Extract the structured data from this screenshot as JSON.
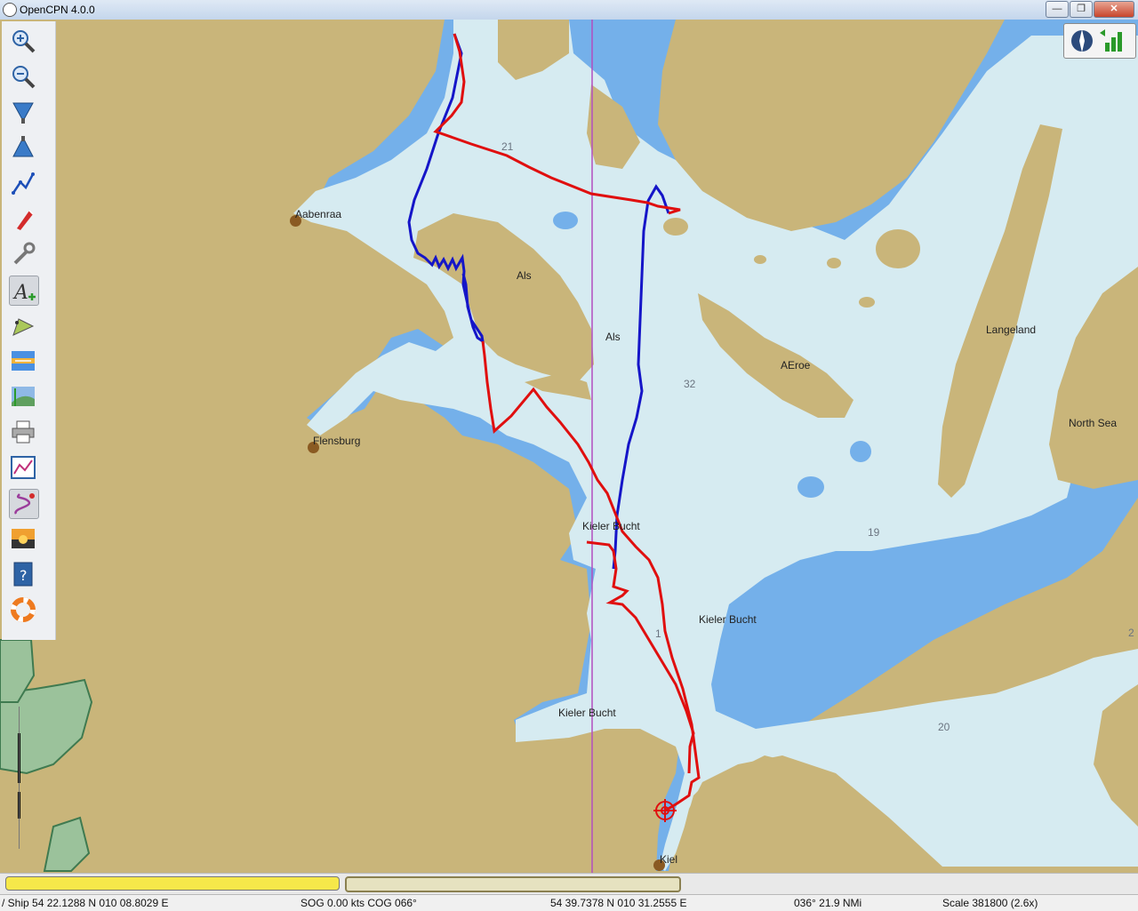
{
  "window": {
    "title": "OpenCPN 4.0.0",
    "minimize": "—",
    "maximize": "❐",
    "close": "✕"
  },
  "colors": {
    "land": "#c9b57a",
    "shallow": "#74b0ea",
    "deep": "#d6ebf1",
    "route_blue": "#1515c8",
    "track_red": "#e00f0f",
    "meridian": "#b24ec0"
  },
  "toolbar": {
    "items": [
      {
        "name": "zoom-in-tool",
        "icon": "zoom-in-icon"
      },
      {
        "name": "zoom-out-tool",
        "icon": "zoom-out-icon"
      },
      {
        "name": "scale-in-tool",
        "icon": "chart-scale-in-icon"
      },
      {
        "name": "scale-out-tool",
        "icon": "chart-scale-out-icon"
      },
      {
        "name": "route-tool",
        "icon": "route-icon"
      },
      {
        "name": "auto-follow-tool",
        "icon": "ship-follow-icon"
      },
      {
        "name": "settings-tool",
        "icon": "wrench-icon"
      },
      {
        "name": "text-tool",
        "icon": "text-add-icon",
        "active": true
      },
      {
        "name": "current-tool",
        "icon": "current-arrow-icon"
      },
      {
        "name": "tide-tool",
        "icon": "tide-icon"
      },
      {
        "name": "route-manager-tool",
        "icon": "route-manager-icon"
      },
      {
        "name": "print-tool",
        "icon": "printer-icon"
      },
      {
        "name": "chart-tool",
        "icon": "chart-graph-icon"
      },
      {
        "name": "track-tool",
        "icon": "track-icon",
        "active": true
      },
      {
        "name": "color-scheme-tool",
        "icon": "sunset-icon"
      },
      {
        "name": "help-tool",
        "icon": "help-book-icon"
      },
      {
        "name": "mob-tool",
        "icon": "lifebuoy-icon"
      }
    ]
  },
  "map_labels": {
    "aabenraa": "Aabenraa",
    "als1": "Als",
    "als2": "Als",
    "flensburg": "Flensburg",
    "aeroe": "AEroe",
    "langeland": "Langeland",
    "north_sea": "North Sea",
    "kieler1": "Kieler Bucht",
    "kieler2": "Kieler Bucht",
    "kieler3": "Kieler Bucht",
    "kiel": "Kiel"
  },
  "depths": {
    "d1": "21",
    "d2": "32",
    "d3": "19",
    "d4": "1",
    "d5": "20",
    "d6": "2"
  },
  "status": {
    "ship": "/ Ship 54 22.1288 N   010 08.8029 E",
    "sog": "SOG 0.00 kts  COG 066°",
    "cursor": "54 39.7378 N   010 31.2555 E",
    "bearing": "036°   21.9 NMi",
    "scale": "Scale 381800 (2.6x)"
  }
}
